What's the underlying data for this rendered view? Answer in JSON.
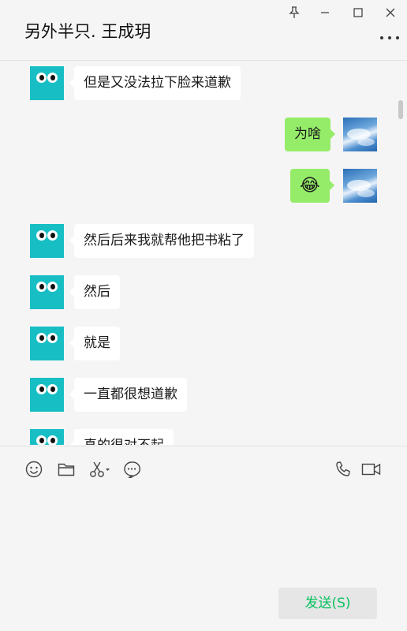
{
  "header": {
    "title": "另外半只. 王成玥"
  },
  "window_controls": [
    "pin-icon",
    "minimize-icon",
    "maximize-icon",
    "close-icon"
  ],
  "messages": [
    {
      "side": "left",
      "text": "但是又没法拉下脸来道歉"
    },
    {
      "side": "right",
      "text": "为啥"
    },
    {
      "side": "right",
      "text": "😂"
    },
    {
      "side": "left",
      "text": "然后后来我就帮他把书粘了"
    },
    {
      "side": "left",
      "text": "然后"
    },
    {
      "side": "left",
      "text": "就是"
    },
    {
      "side": "left",
      "text": "一直都很想道歉"
    },
    {
      "side": "left",
      "text": "真的很对不起"
    }
  ],
  "toolbar": {
    "left_icons": [
      "emoji-icon",
      "folder-icon",
      "scissors-icon",
      "chat-history-icon"
    ],
    "right_icons": [
      "phone-icon",
      "video-call-icon"
    ]
  },
  "composer": {
    "send_label": "发送(S)"
  },
  "colors": {
    "self_bubble": "#95ec69",
    "other_bubble": "#ffffff",
    "send_text": "#07c160",
    "avatar_bg": "#17bfc5"
  }
}
